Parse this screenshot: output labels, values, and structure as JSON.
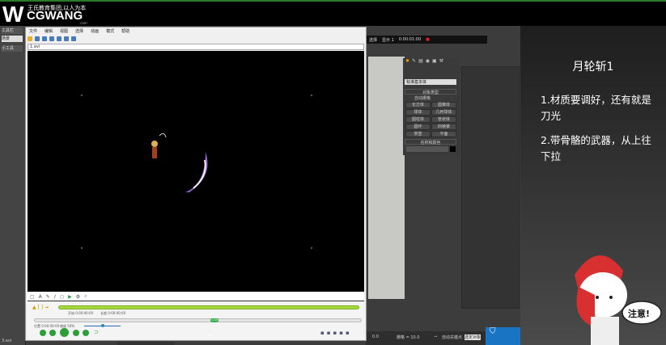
{
  "logo": {
    "mark": "W",
    "name": "CGWANG",
    "tagline": "王氏教育集团,以人为本",
    "domain": ".com"
  },
  "left_panel": {
    "items": [
      "工具栏",
      "场景",
      "小工具"
    ]
  },
  "player": {
    "menu": [
      "文件",
      "编辑",
      "视图",
      "选择",
      "动画",
      "模式",
      "帮助"
    ],
    "file_label": "1.avi",
    "timeline": {
      "start_label": "开始 0:00:00:00",
      "end_label": "长度 0:00:00:00",
      "position_label": "位置 0:00:00:00",
      "zoom_label": "缩放 50%",
      "marker": "1:33",
      "progress": 0.55,
      "zoom_slider": 0.5
    },
    "status": "3.avi"
  },
  "max": {
    "toolbar": [
      "选择",
      "显示 1",
      "0:00:01:00"
    ],
    "dropdown": "标准基本体",
    "rollout_title": "对象类型",
    "autogrid": "自动栅格",
    "buttons": [
      "长方体",
      "圆锥体",
      "球体",
      "几何球体",
      "圆柱体",
      "管状体",
      "圆环",
      "四棱锥",
      "茶壶",
      "平面"
    ],
    "name_rollout": "名称和颜色",
    "status": [
      "0.0",
      "栅格 = 10.0",
      "自动关键点",
      "选定对象"
    ]
  },
  "slide": {
    "title": "月轮斩1",
    "notes": [
      "1.材质要调好，还有就是刀光",
      "2.带骨骼的武器，从上往下拉"
    ]
  },
  "mascot": {
    "speech": "注意!"
  },
  "colors": {
    "accent_green": "#a8d840",
    "panel": "#3c3c3c",
    "win_blue": "#1a74c4"
  }
}
